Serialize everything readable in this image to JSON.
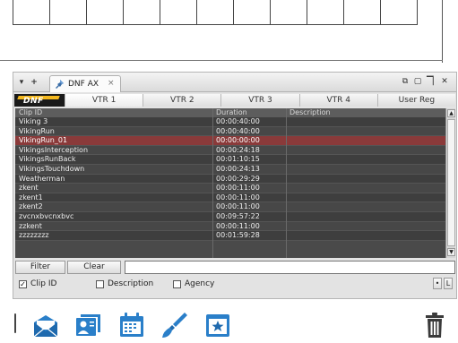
{
  "panel": {
    "tab_title": "DNF AX",
    "tab_close": "×",
    "add_tab": "+",
    "menu_arrow": "▾",
    "window_controls": [
      "⧉",
      "▢",
      "▔▏",
      "✕"
    ]
  },
  "brand": {
    "logo_text": "DNF",
    "logo_stripe_color": "#f3b81f"
  },
  "vtr_tabs": [
    "VTR 1",
    "VTR 2",
    "VTR 3",
    "VTR 4",
    "User Reg"
  ],
  "columns": {
    "clip_id": "Clip ID",
    "duration": "Duration",
    "description": "Description"
  },
  "rows": [
    {
      "id": "Viking 3",
      "duration": "00:00:40:00",
      "description": ""
    },
    {
      "id": "VikingRun",
      "duration": "00:00:40:00",
      "description": ""
    },
    {
      "id": "VikingRun_01",
      "duration": "00:00:00:00",
      "description": "",
      "selected": true
    },
    {
      "id": "VikingsInterception",
      "duration": "00:00:24:18",
      "description": ""
    },
    {
      "id": "VikingsRunBack",
      "duration": "00:01:10:15",
      "description": ""
    },
    {
      "id": "VikingsTouchdown",
      "duration": "00:00:24:13",
      "description": ""
    },
    {
      "id": "Weatherman",
      "duration": "00:00:29:29",
      "description": ""
    },
    {
      "id": "zkent",
      "duration": "00:00:11:00",
      "description": ""
    },
    {
      "id": "zkent1",
      "duration": "00:00:11:00",
      "description": ""
    },
    {
      "id": "zkent2",
      "duration": "00:00:11:00",
      "description": ""
    },
    {
      "id": "zvcnxbvcnxbvc",
      "duration": "00:09:57:22",
      "description": ""
    },
    {
      "id": "zzkent",
      "duration": "00:00:11:00",
      "description": ""
    },
    {
      "id": "zzzzzzzz",
      "duration": "00:01:59:28",
      "description": ""
    }
  ],
  "filter": {
    "filter_label": "Filter",
    "clear_label": "Clear",
    "input_value": ""
  },
  "checkboxes": [
    {
      "label": "Clip ID",
      "checked": true
    },
    {
      "label": "Description",
      "checked": false
    },
    {
      "label": "Agency",
      "checked": false
    }
  ],
  "small_buttons": [
    "•",
    "L"
  ],
  "scroll": {
    "up": "▲",
    "down": "▼"
  },
  "taskbar_icons": [
    "mail-icon",
    "people-card-icon",
    "calendar-icon",
    "brush-icon",
    "star-window-icon",
    "trash-icon"
  ],
  "colors": {
    "selected_row": "#8a3a3a",
    "list_bg": "#4a4a4a",
    "accent_blue": "#2a7fc9"
  }
}
